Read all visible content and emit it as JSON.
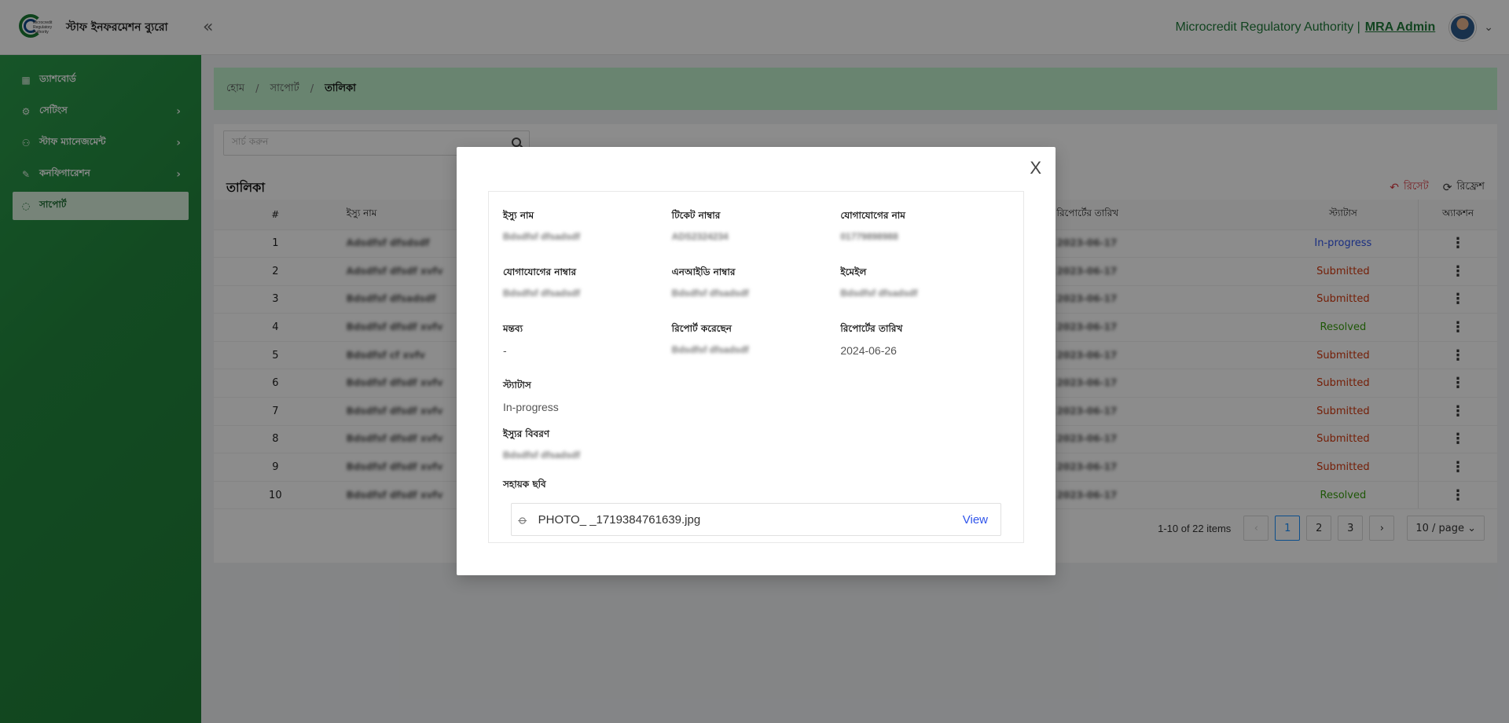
{
  "header": {
    "logo_text": "Microcredit Regulatory Authority",
    "brand": "স্টাফ ইনফরমেশন ব্যুরো",
    "org": "Microcredit Regulatory Authority |",
    "user": "MRA Admin"
  },
  "sidebar": {
    "items": [
      {
        "label": "ড্যাশবোর্ড",
        "icon": "dashboard-icon",
        "has_arrow": false
      },
      {
        "label": "সেটিংস",
        "icon": "gear-icon",
        "has_arrow": true
      },
      {
        "label": "স্টাফ ম্যানেজমেন্ট",
        "icon": "users-icon",
        "has_arrow": true
      },
      {
        "label": "কনফিগারেশন",
        "icon": "wrench-icon",
        "has_arrow": true
      },
      {
        "label": "সাপোর্ট",
        "icon": "support-icon",
        "has_arrow": false,
        "active": true
      }
    ]
  },
  "breadcrumb": [
    "হোম",
    "সাপোর্ট",
    "তালিকা"
  ],
  "search": {
    "placeholder": "সার্চ করুন"
  },
  "list": {
    "title": "তালিকা",
    "reset": "রিসেট",
    "refresh": "রিফ্রেশ",
    "columns": {
      "num": "#",
      "issue": "ইস্যু নাম",
      "report_date": "রিপোর্টের তারিখ",
      "status": "স্ট্যাটাস",
      "action": "অ্যাকশন"
    },
    "rows": [
      {
        "num": "1",
        "issue": "Adsdfsf dfsdsdf",
        "date": "2023-06-17",
        "status": "In-progress",
        "status_type": "prog"
      },
      {
        "num": "2",
        "issue": "Adsdfsf dfsdf xvfv",
        "date": "2023-06-17",
        "status": "Submitted",
        "status_type": "sub"
      },
      {
        "num": "3",
        "issue": "Bdsdfsf dfsadsdf",
        "date": "2023-06-17",
        "status": "Submitted",
        "status_type": "sub"
      },
      {
        "num": "4",
        "issue": "Bdsdfsf dfsdf xvfv",
        "date": "2023-06-17",
        "status": "Resolved",
        "status_type": "res"
      },
      {
        "num": "5",
        "issue": "Bdsdfsf cf xvfv",
        "date": "2023-06-17",
        "status": "Submitted",
        "status_type": "sub"
      },
      {
        "num": "6",
        "issue": "Bdsdfsf dfsdf xvfv",
        "date": "2023-06-17",
        "status": "Submitted",
        "status_type": "sub"
      },
      {
        "num": "7",
        "issue": "Bdsdfsf dfsdf xvfv",
        "date": "2023-06-17",
        "status": "Submitted",
        "status_type": "sub"
      },
      {
        "num": "8",
        "issue": "Bdsdfsf dfsdf xvfv",
        "date": "2023-06-17",
        "status": "Submitted",
        "status_type": "sub"
      },
      {
        "num": "9",
        "issue": "Bdsdfsf dfsdf xvfv",
        "date": "2023-06-17",
        "status": "Submitted",
        "status_type": "sub"
      },
      {
        "num": "10",
        "issue": "Bdsdfsf dfsdf xvfv",
        "date": "2023-06-17",
        "status": "Resolved",
        "status_type": "res"
      }
    ]
  },
  "pagination": {
    "total": "1-10 of 22 items",
    "pages": [
      "1",
      "2",
      "3"
    ],
    "current": "1",
    "size": "10 / page"
  },
  "modal": {
    "close": "X",
    "fields": [
      {
        "label": "ইস্যু নাম",
        "value": "Bdsdfsf dfsadsdf",
        "blurred": true
      },
      {
        "label": "টিকেট নাম্বার",
        "value": "ADS2324234",
        "blurred": true
      },
      {
        "label": "যোগাযোগের নাম",
        "value": "01779898988",
        "blurred": true
      },
      {
        "label": "যোগাযোগের নাম্বার",
        "value": "Bdsdfsf dfsadsdf",
        "blurred": true
      },
      {
        "label": "এনআইডি নাম্বার",
        "value": "Bdsdfsf dfsadsdf",
        "blurred": true
      },
      {
        "label": "ইমেইল",
        "value": "Bdsdfsf dfsadsdf",
        "blurred": true
      },
      {
        "label": "মন্তব্য",
        "value": "-",
        "blurred": false
      },
      {
        "label": "রিপোর্ট করেছেন",
        "value": "Bdsdfsf dfsadsdf",
        "blurred": true
      },
      {
        "label": "রিপোর্টের তারিখ",
        "value": "2024-06-26",
        "blurred": false
      }
    ],
    "status_label": "স্ট্যাটাস",
    "status_value": "In-progress",
    "desc_label": "ইস্যুর বিবরণ",
    "desc_value": "Bdsdfsf dfsadsdf",
    "image_label": "সহায়ক ছবি",
    "file_name": "PHOTO_ _1719384761639.jpg",
    "view": "View"
  }
}
